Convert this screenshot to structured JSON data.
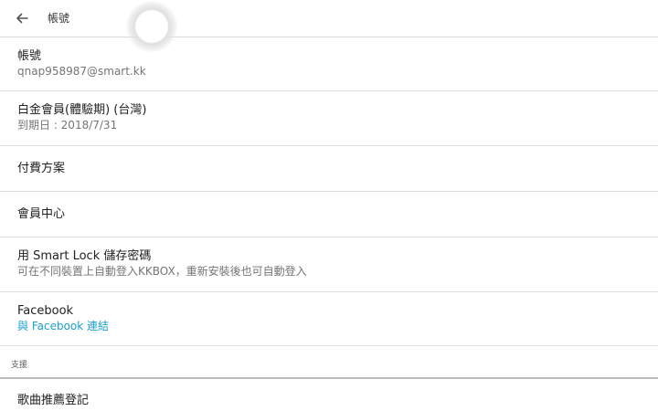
{
  "toolbar": {
    "back_icon": "arrow-left-icon",
    "title": "帳號"
  },
  "rows": {
    "account": {
      "title": "帳號",
      "subtitle": "qnap958987@smart.kk"
    },
    "plan": {
      "title": "白金會員(體驗期) (台灣)",
      "subtitle": "到期日 : 2018/7/31"
    },
    "payment": {
      "title": "付費方案"
    },
    "member_center": {
      "title": "會員中心"
    },
    "smart_lock": {
      "title": "用 Smart Lock 儲存密碼",
      "subtitle": "可在不同裝置上自動登入KKBOX，重新安裝後也可自動登入"
    },
    "facebook": {
      "title": "Facebook",
      "subtitle": "與 Facebook 連結"
    }
  },
  "support_section": {
    "label": "支援",
    "items": {
      "song_recommend": {
        "title": "歌曲推薦登記"
      }
    }
  },
  "colors": {
    "link": "#1a9fd0",
    "divider": "#e0e0e0",
    "secondary_text": "#757575"
  }
}
